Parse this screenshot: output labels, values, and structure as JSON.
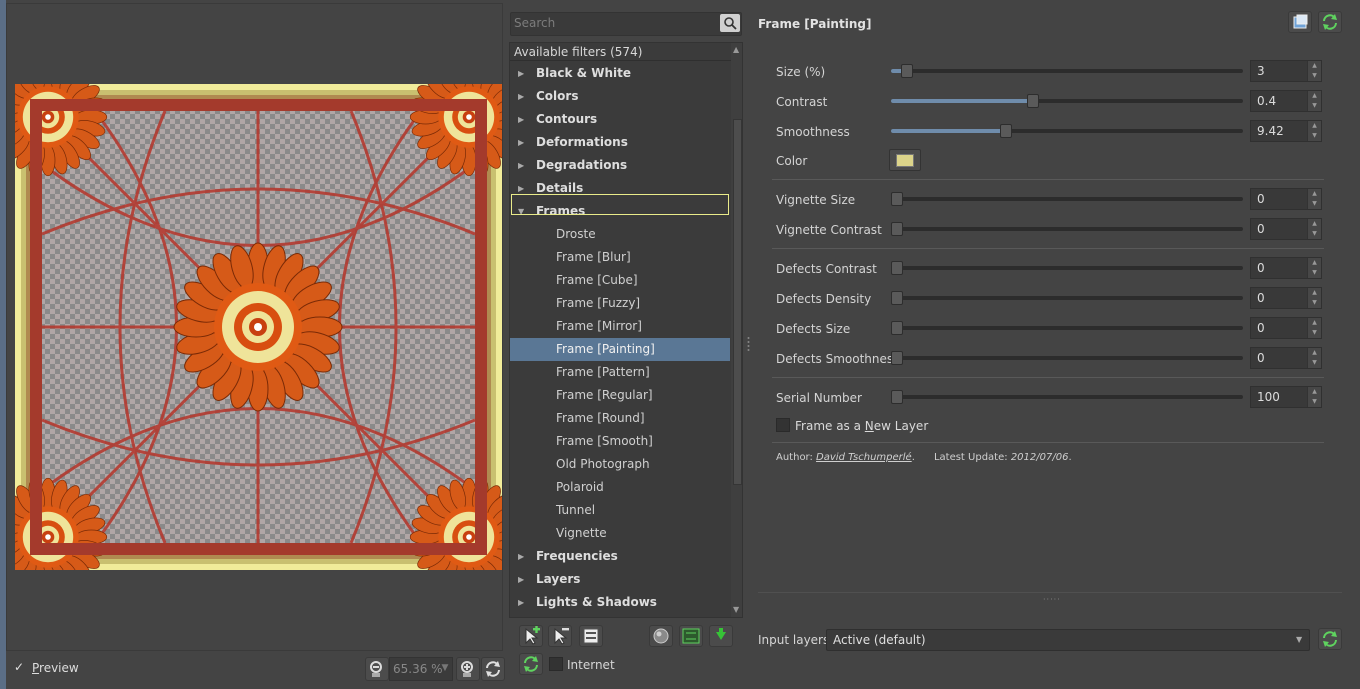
{
  "preview": {
    "checkbox_mark": "✓",
    "label_pre": "",
    "label_ul": "P",
    "label_post": "review",
    "zoom_value": "65.36 %"
  },
  "search": {
    "placeholder": "Search"
  },
  "filters": {
    "header": "Available filters (574)",
    "categories_before": [
      "Black & White",
      "Colors",
      "Contours",
      "Deformations",
      "Degradations",
      "Details"
    ],
    "open_category": "Frames",
    "items": [
      "Droste",
      "Frame [Blur]",
      "Frame [Cube]",
      "Frame [Fuzzy]",
      "Frame [Mirror]",
      "Frame [Painting]",
      "Frame [Pattern]",
      "Frame [Regular]",
      "Frame [Round]",
      "Frame [Smooth]",
      "Old Photograph",
      "Polaroid",
      "Tunnel",
      "Vignette"
    ],
    "selected_item": "Frame [Painting]",
    "categories_after": [
      "Frequencies",
      "Layers",
      "Lights & Shadows"
    ]
  },
  "internet": {
    "label": "Internet"
  },
  "settings": {
    "title": "Frame [Painting]",
    "params": [
      {
        "label": "Size (%)",
        "value": "3",
        "level": 0.03
      },
      {
        "label": "Contrast",
        "value": "0.4",
        "level": 0.4
      },
      {
        "label": "Smoothness",
        "value": "9.42",
        "level": 0.32
      }
    ],
    "color_label": "Color",
    "color_value": "#dcd48a",
    "vignette": [
      {
        "label": "Vignette Size",
        "value": "0",
        "level": 0
      },
      {
        "label": "Vignette Contrast",
        "value": "0",
        "level": 0
      }
    ],
    "defects": [
      {
        "label": "Defects Contrast",
        "value": "0",
        "level": 0
      },
      {
        "label": "Defects Density",
        "value": "0",
        "level": 0
      },
      {
        "label": "Defects Size",
        "value": "0",
        "level": 0
      },
      {
        "label": "Defects Smoothness",
        "value": "0",
        "level": 0
      }
    ],
    "serial": {
      "label": "Serial Number",
      "value": "100",
      "level": 0
    },
    "new_layer_pre": "Frame as a ",
    "new_layer_ul": "N",
    "new_layer_post": "ew Layer",
    "author_prefix": "Author: ",
    "author_name": "David Tschumperlé",
    "author_suffix": ".",
    "update_prefix": "Latest Update: ",
    "update_date": "2012/07/06",
    "update_suffix": "."
  },
  "input_layers": {
    "label": "Input layers",
    "value": "Active (default)"
  },
  "colors": {
    "accent": "#5a7795",
    "highlight": "#e9eb8a",
    "bg": "#444444"
  }
}
